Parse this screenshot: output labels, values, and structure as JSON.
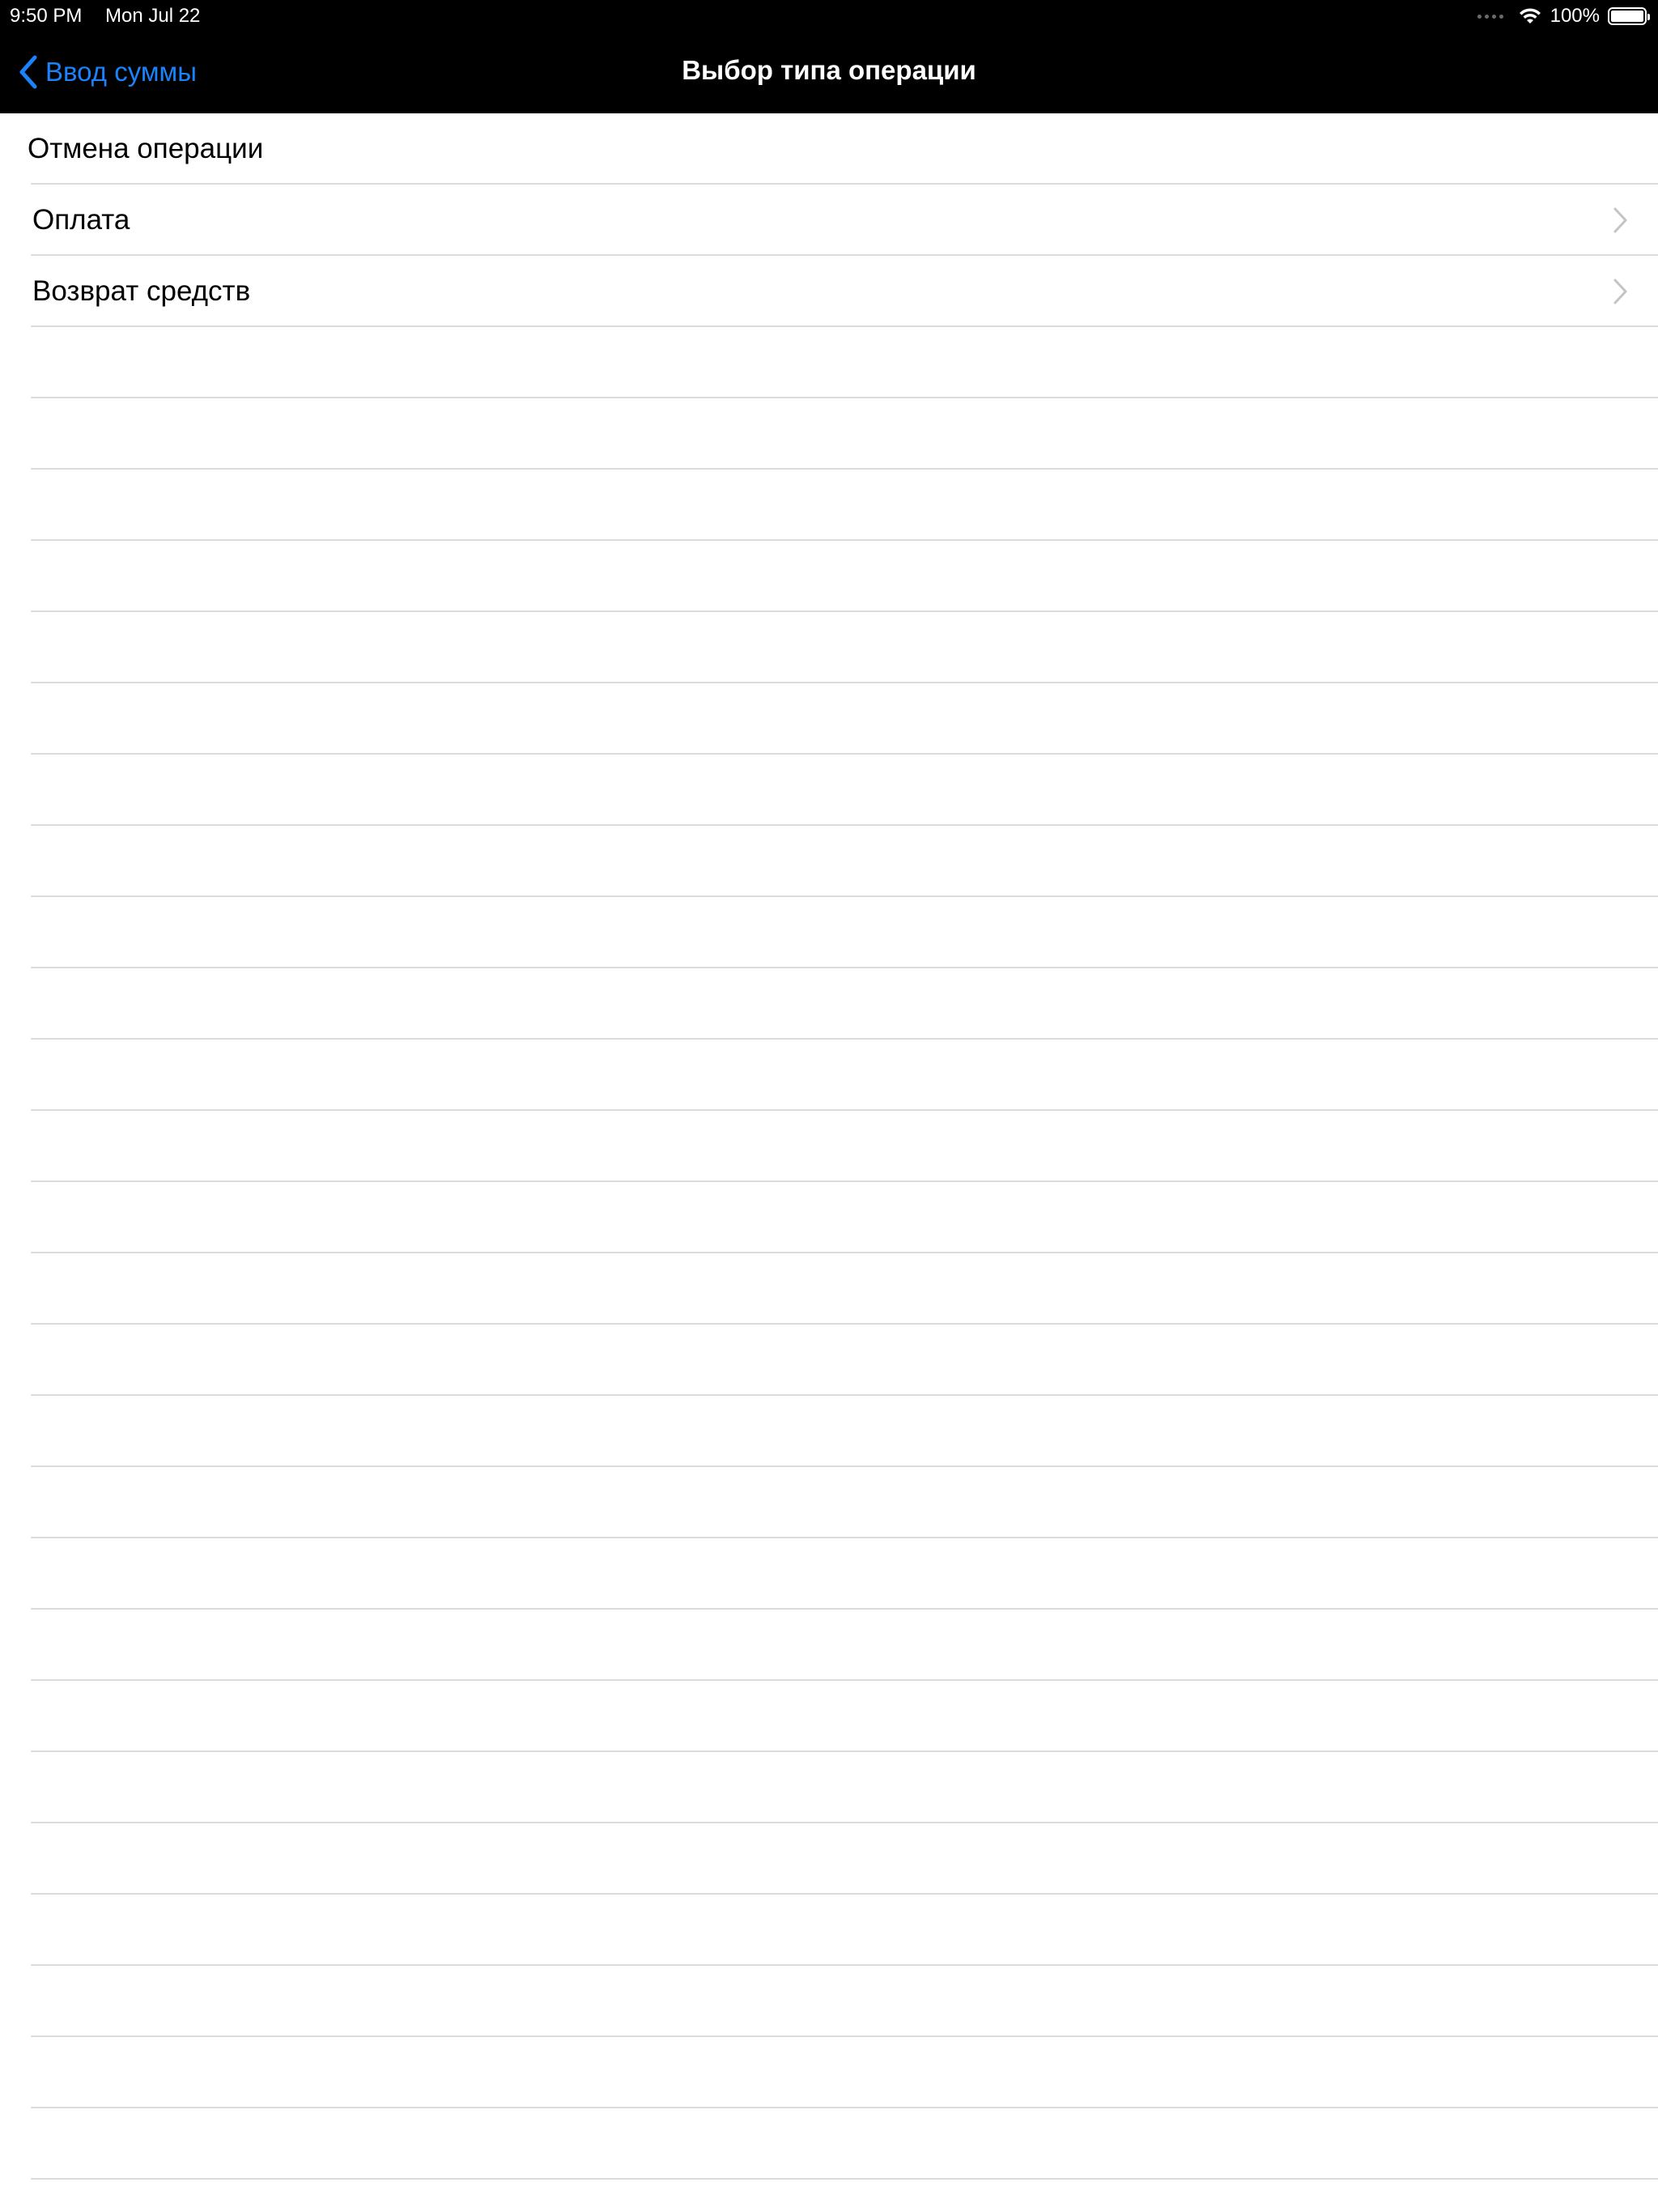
{
  "status_bar": {
    "time": "9:50 PM",
    "date": "Mon Jul 22",
    "battery_percent": "100%",
    "icons": [
      "signal-dots-icon",
      "wifi-icon",
      "battery-icon"
    ]
  },
  "nav_bar": {
    "back_label": "Ввод суммы",
    "title": "Выбор типа операции",
    "accent_color": "#1a82fb",
    "background_color": "#000000"
  },
  "list": {
    "rows": [
      {
        "label": "Отмена операции",
        "has_chevron": false
      },
      {
        "label": "Оплата",
        "has_chevron": true
      },
      {
        "label": "Возврат средств",
        "has_chevron": true
      }
    ],
    "empty_row_count": 26,
    "separator_color": "#dcdce0"
  }
}
